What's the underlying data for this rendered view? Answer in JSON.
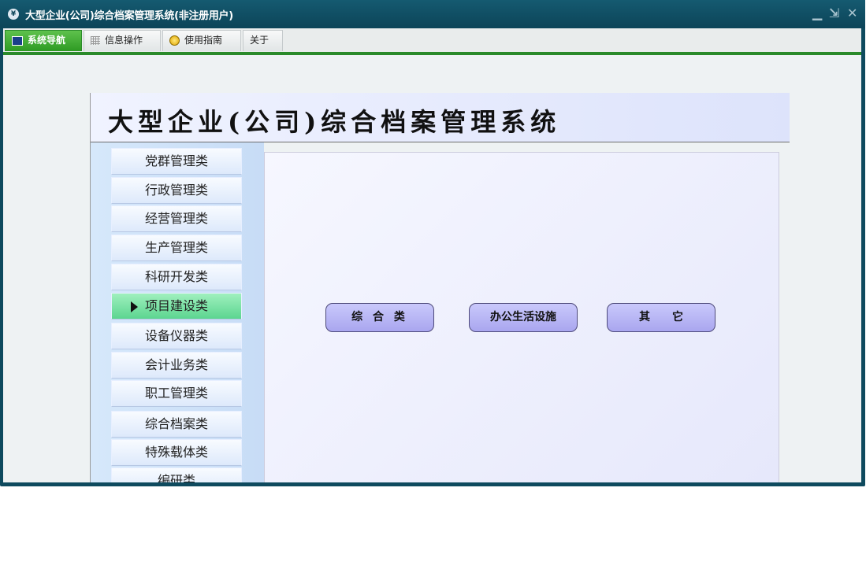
{
  "window": {
    "icon_label": "¥",
    "title": "大型企业(公司)综合档案管理系统(非注册用户)",
    "controls": {
      "minimize": "▁",
      "restore": "⇲",
      "close": "✕"
    }
  },
  "tabs": [
    {
      "label": "系统导航",
      "icon": "monitor-icon",
      "active": true
    },
    {
      "label": "信息操作",
      "icon": "grid-icon",
      "active": false
    },
    {
      "label": "使用指南",
      "icon": "bulb-icon",
      "active": false
    },
    {
      "label": "关于",
      "icon": "",
      "active": false
    }
  ],
  "banner": {
    "title": "大型企业(公司)综合档案管理系统"
  },
  "nav": {
    "items": [
      "党群管理类",
      "行政管理类",
      "经营管理类",
      "生产管理类",
      "科研开发类",
      "项目建设类",
      "设备仪器类",
      "会计业务类",
      "职工管理类",
      "综合档案类",
      "特殊载体类",
      "编研类"
    ],
    "active_index": 5
  },
  "content": {
    "buttons": [
      "综 合 类",
      "办公生活设施",
      "其　　它"
    ]
  },
  "colors": {
    "title_bar": "#0c4458",
    "tab_active": "#2d9a23",
    "accent_line": "#2a8a2a",
    "nav_active": "#5cd590",
    "button": "#b9b7f5"
  }
}
